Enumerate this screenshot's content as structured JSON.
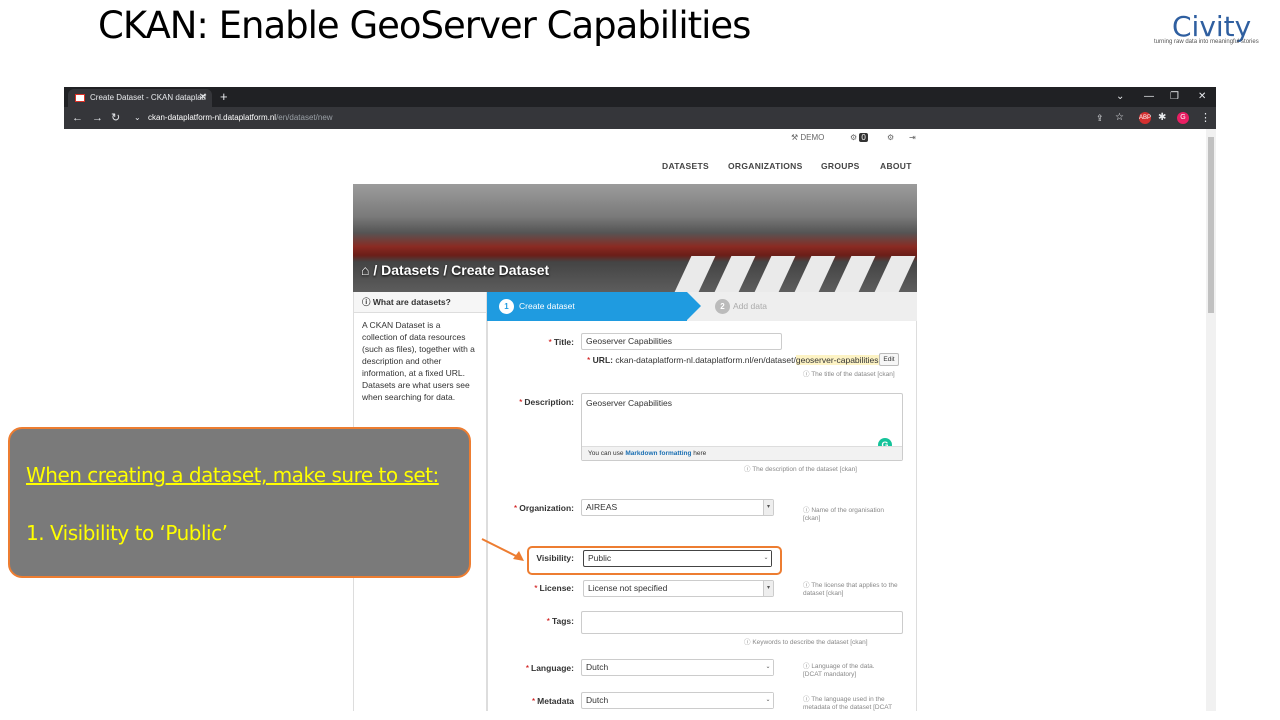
{
  "slide": {
    "title": "CKAN: Enable GeoServer Capabilities",
    "logo_text": "Civity",
    "logo_tagline": "turning raw data into meaningful stories"
  },
  "browser": {
    "tab_title": "Create Dataset - CKAN dataplatf",
    "url_host": "ckan-dataplatform-nl.dataplatform.nl",
    "url_path": "/en/dataset/new"
  },
  "site": {
    "account": {
      "user": "DEMO",
      "notifications": "0"
    },
    "nav": [
      "DATASETS",
      "ORGANIZATIONS",
      "GROUPS",
      "ABOUT"
    ],
    "breadcrumb": "/ Datasets / Create Dataset"
  },
  "sidebar": {
    "heading": "What are datasets?",
    "body": "A CKAN Dataset is a collection of data resources (such as files), together with a description and other information, at a fixed URL. Datasets are what users see when searching for data."
  },
  "steps": {
    "step1_num": "1",
    "step1_label": "Create dataset",
    "step2_num": "2",
    "step2_label": "Add data"
  },
  "form": {
    "title": {
      "label": "Title:",
      "value": "Geoserver Capabilities",
      "help": "The title of the dataset [ckan]"
    },
    "url": {
      "label": "URL:",
      "prefix": "ckan-dataplatform-nl.dataplatform.nl/en/dataset/",
      "slug": "geoserver-capabilities",
      "edit": "Edit"
    },
    "description": {
      "label": "Description:",
      "value": "Geoserver Capabilities",
      "hint_pre": "You can use",
      "hint_link": "Markdown formatting",
      "hint_post": "here",
      "help": "The description of the dataset [ckan]"
    },
    "organization": {
      "label": "Organization:",
      "value": "AIREAS",
      "help": "Name of the organisation [ckan]"
    },
    "visibility": {
      "label": "Visibility:",
      "value": "Public"
    },
    "license": {
      "label": "License:",
      "value": "License not specified",
      "help": "The license that applies to the dataset [ckan]"
    },
    "tags": {
      "label": "Tags:",
      "value": "",
      "help": "Keywords to describe the dataset [ckan]"
    },
    "language": {
      "label": "Language:",
      "value": "Dutch",
      "help": "Language of the data. [DCAT mandatory]"
    },
    "metadata_language": {
      "label": "Metadata",
      "value": "Dutch",
      "help": "The language used in the metadata of the dataset [DCAT"
    }
  },
  "callout": {
    "line1": "When creating a dataset, make sure to set:",
    "line2": "1. Visibility to ‘Public’"
  },
  "colors": {
    "accent": "#ed7d31",
    "callout_text": "#ffff00",
    "step_active": "#1f9be0"
  }
}
